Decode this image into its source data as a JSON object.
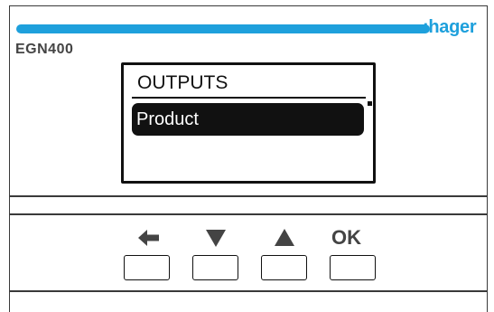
{
  "device": {
    "brand": ":hager",
    "model": "EGN400",
    "brand_color": "#1ea0dc"
  },
  "display": {
    "title": "OUTPUTS",
    "items": [
      {
        "label": "Product",
        "selected": true
      }
    ]
  },
  "keys": [
    {
      "icon": "arrow-left-icon",
      "label": ""
    },
    {
      "icon": "triangle-down-icon",
      "label": ""
    },
    {
      "icon": "triangle-up-icon",
      "label": ""
    },
    {
      "icon": "",
      "label": "OK"
    }
  ]
}
